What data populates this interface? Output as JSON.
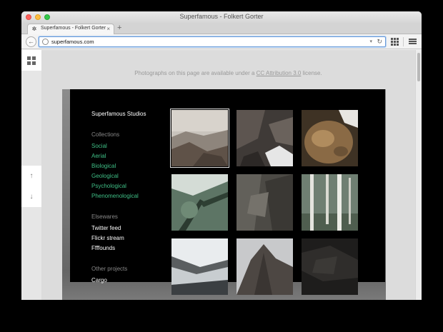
{
  "window": {
    "title": "Superfamous - Folkert Gorter"
  },
  "tabs": [
    {
      "label": "Superfamous - Folkert Gorter"
    }
  ],
  "toolbar": {
    "url": "superfamous.com"
  },
  "page": {
    "notice_prefix": "Photographs on this page are available under a ",
    "notice_link": "CC Attribution 3.0",
    "notice_suffix": " license."
  },
  "sidebar": {
    "title": "Superfamous Studios",
    "collections_label": "Collections",
    "collections": [
      "Social",
      "Aerial",
      "Biological",
      "Geological",
      "Psychological",
      "Phenomenological"
    ],
    "elsewares_label": "Elsewares",
    "elsewares": [
      "Twitter feed",
      "Flickr stream",
      "Ffffounds"
    ],
    "other_label": "Other projects",
    "other": [
      "Cargo"
    ]
  },
  "colors": {
    "accent": "#3fbf86",
    "panel": "#000000"
  },
  "photos": [
    {
      "name": "coastal-landscape",
      "selected": true
    },
    {
      "name": "rock-surf"
    },
    {
      "name": "mossy-stone"
    },
    {
      "name": "tree-branches"
    },
    {
      "name": "rock-face"
    },
    {
      "name": "birch-trees"
    },
    {
      "name": "ocean-waves"
    },
    {
      "name": "mountain-peak"
    },
    {
      "name": "dark-rocks"
    }
  ]
}
